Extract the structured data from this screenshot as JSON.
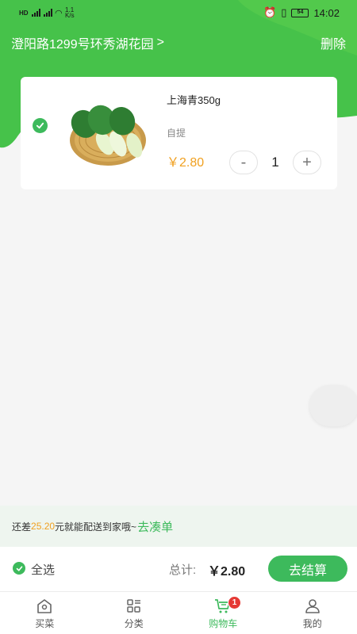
{
  "status_bar": {
    "net_speed": "1.1\nK/s",
    "battery": "54",
    "time": "14:02"
  },
  "header": {
    "address": "澄阳路1299号环秀湖花园",
    "chevron": ">",
    "delete_label": "删除"
  },
  "cart": {
    "items": [
      {
        "name": "上海青350g",
        "delivery": "自提",
        "price": "￥2.80",
        "quantity": "1",
        "minus_label": "-",
        "plus_label": "+",
        "selected": true,
        "image_icon": "bok-choy-image"
      }
    ]
  },
  "promo": {
    "prefix": "还差",
    "amount": "25.20",
    "suffix": "元就能配送到家哦~",
    "link": "去凑单"
  },
  "checkout": {
    "select_all_label": "全选",
    "total_label": "总计:",
    "total_value": "￥2.80",
    "settle_label": "去结算"
  },
  "tabbar": {
    "tabs": [
      {
        "label": "买菜",
        "icon": "home-icon"
      },
      {
        "label": "分类",
        "icon": "category-icon"
      },
      {
        "label": "购物车",
        "icon": "cart-icon",
        "active": true,
        "badge": "1"
      },
      {
        "label": "我的",
        "icon": "profile-icon"
      }
    ]
  },
  "colors": {
    "accent": "#3dba5c",
    "price": "#f0a020",
    "badge": "#e53935"
  }
}
